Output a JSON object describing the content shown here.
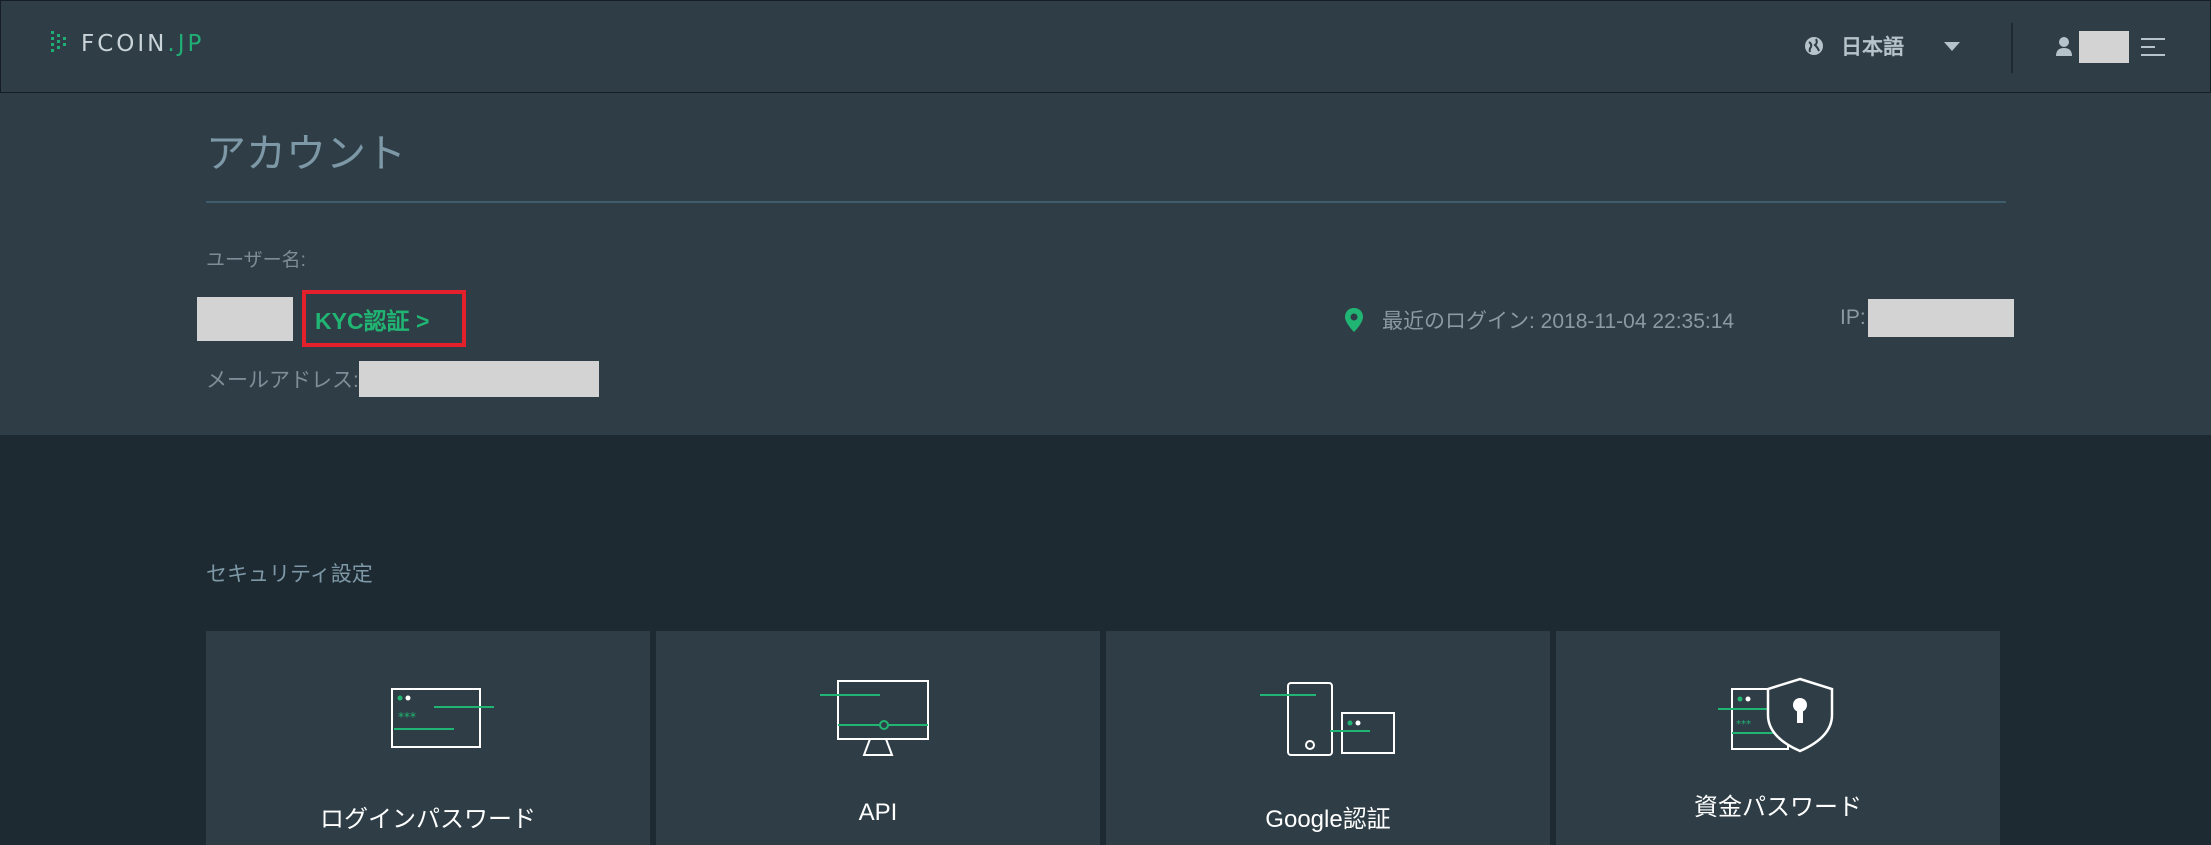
{
  "header": {
    "logo_main": "FCOIN",
    "logo_suffix": ".JP",
    "language": "日本語"
  },
  "account": {
    "title": "アカウント",
    "username_label": "ユーザー名:",
    "kyc_link": "KYC認証 >",
    "email_label": "メールアドレス:",
    "last_login": "最近のログイン: 2018-11-04 22:35:14",
    "ip_label": "IP:"
  },
  "security": {
    "title": "セキュリティ設定",
    "cards": [
      {
        "label": "ログインパスワード",
        "icon": "login-password-icon"
      },
      {
        "label": "API",
        "icon": "api-monitor-icon"
      },
      {
        "label": "Google認証",
        "icon": "google-auth-device-icon"
      },
      {
        "label": "資金パスワード",
        "icon": "fund-password-shield-icon"
      }
    ]
  },
  "colors": {
    "accent": "#21b573",
    "panel": "#2f3e46",
    "background": "#1e2a32",
    "highlight_box": "#e4202d"
  }
}
